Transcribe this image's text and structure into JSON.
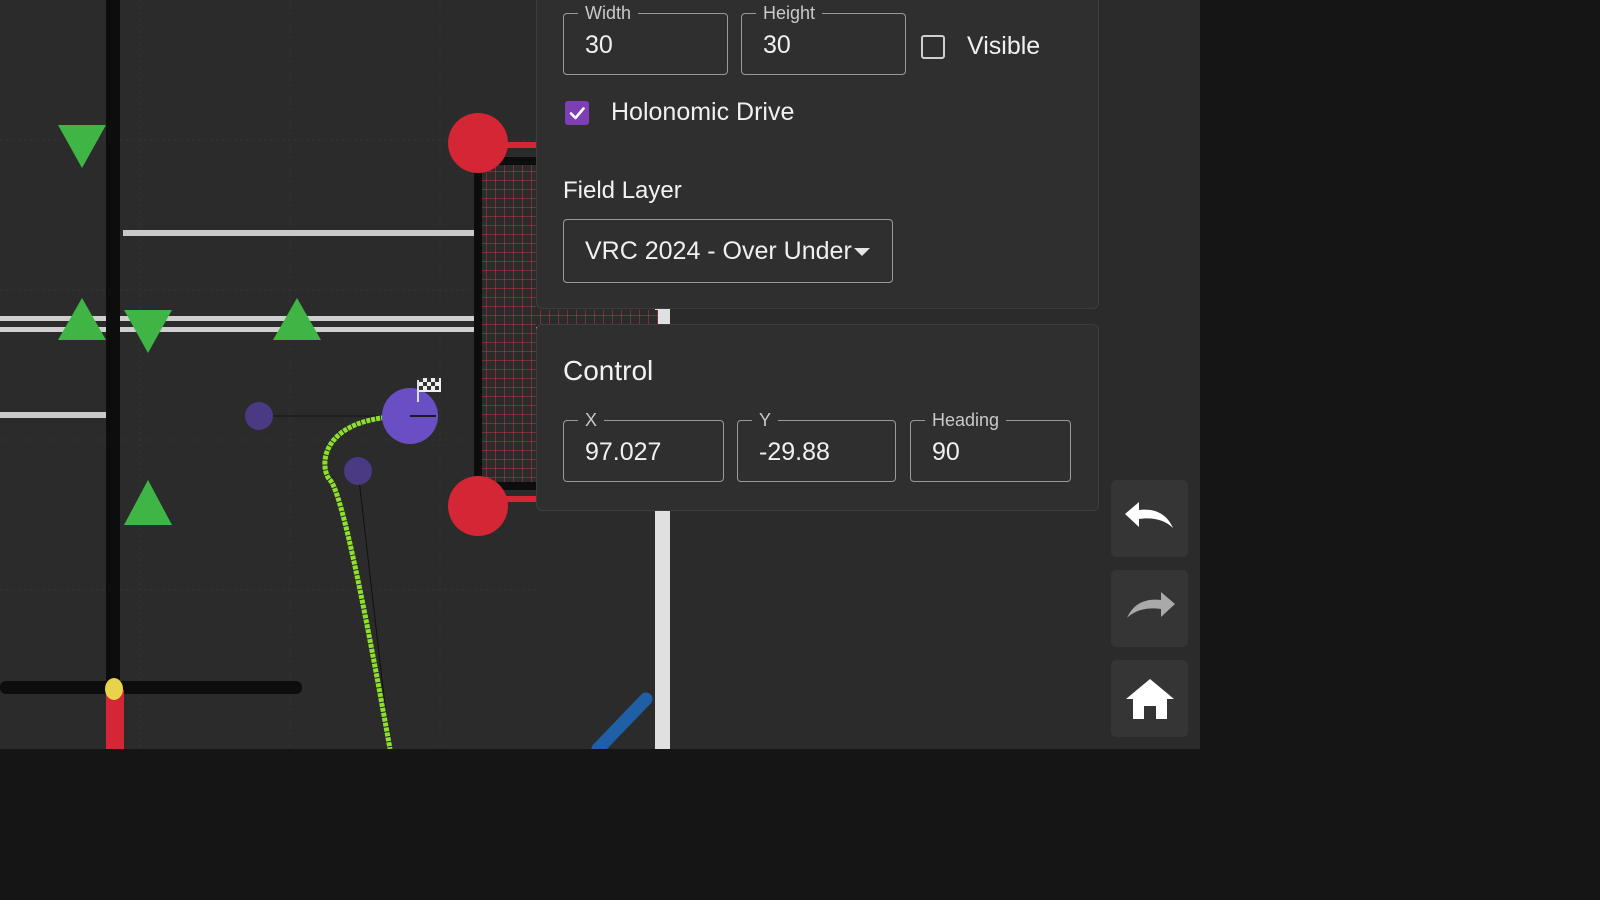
{
  "robot": {
    "width_label": "Width",
    "width_value": "30",
    "height_label": "Height",
    "height_value": "30",
    "visible_label": "Visible",
    "visible_checked": false,
    "holonomic_label": "Holonomic Drive",
    "holonomic_checked": true,
    "field_layer_title": "Field Layer",
    "field_layer_value": "VRC 2024 - Over Under"
  },
  "control": {
    "title": "Control",
    "x_label": "X",
    "x_value": "97.027",
    "y_label": "Y",
    "y_value": "-29.88",
    "heading_label": "Heading",
    "heading_value": "90"
  },
  "toolbar": {
    "undo_icon": "undo-icon",
    "redo_icon": "redo-icon",
    "home_icon": "home-icon"
  },
  "colors": {
    "accent": "#7e3fb5",
    "path": "#8fe02a",
    "triball": "#3fb545",
    "goal_post": "#d42634",
    "waypoint": "#6a4fc4"
  }
}
